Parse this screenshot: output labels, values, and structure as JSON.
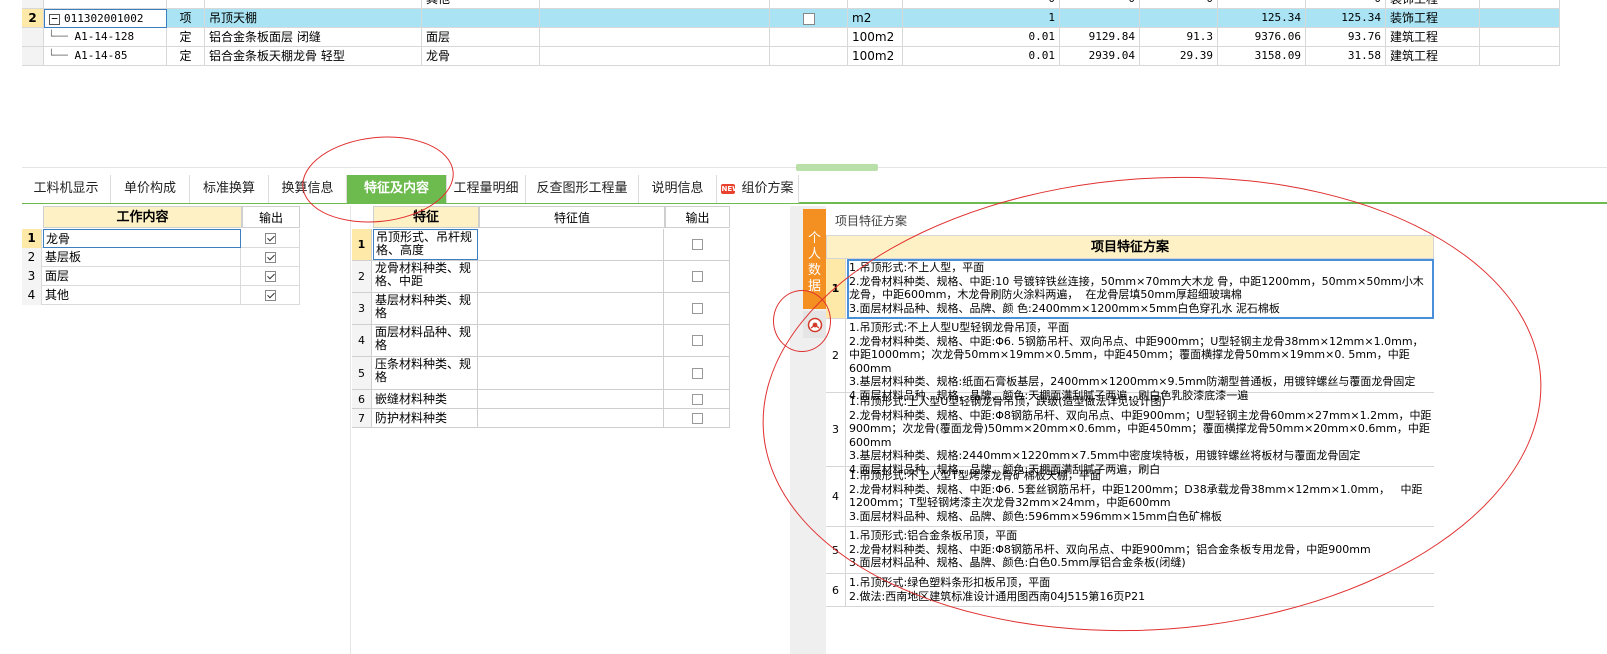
{
  "top_grid": {
    "partial_row": {
      "col_type": "其他",
      "values": [
        "0",
        "0",
        "0",
        "0"
      ],
      "category": "装饰工程"
    },
    "rows": [
      {
        "rownum": "2",
        "code": "011302001002",
        "kind": "项",
        "name": "吊顶天棚",
        "feature": "",
        "unit": "m2",
        "qty": "1",
        "v1": "",
        "v2": "",
        "v3": "125.34",
        "v4": "125.34",
        "category": "装饰工程",
        "selected": true
      },
      {
        "rownum": "",
        "code": "A1-14-128",
        "kind": "定",
        "name": "铝合金条板面层 闭缝",
        "feature": "面层",
        "unit": "100m2",
        "qty": "0.01",
        "v1": "9129.84",
        "v2": "91.3",
        "v3": "9376.06",
        "v4": "93.76",
        "category": "建筑工程",
        "selected": false
      },
      {
        "rownum": "",
        "code": "A1-14-85",
        "kind": "定",
        "name": "铝合金条板天棚龙骨 轻型",
        "feature": "龙骨",
        "unit": "100m2",
        "qty": "0.01",
        "v1": "2939.04",
        "v2": "29.39",
        "v3": "3158.09",
        "v4": "31.58",
        "category": "建筑工程",
        "selected": false
      }
    ]
  },
  "tabs": [
    {
      "label": "工料机显示",
      "active": false
    },
    {
      "label": "单价构成",
      "active": false
    },
    {
      "label": "标准换算",
      "active": false
    },
    {
      "label": "换算信息",
      "active": false
    },
    {
      "label": "特征及内容",
      "active": true
    },
    {
      "label": "工程量明细",
      "active": false
    },
    {
      "label": "反查图形工程量",
      "active": false
    },
    {
      "label": "说明信息",
      "active": false
    },
    {
      "label": "组价方案",
      "active": false,
      "badge": "NEW"
    }
  ],
  "work_content": {
    "header_name": "工作内容",
    "header_output": "输出",
    "items": [
      {
        "rownum": "1",
        "name": "龙骨",
        "checked": true
      },
      {
        "rownum": "2",
        "name": "基层板",
        "checked": true
      },
      {
        "rownum": "3",
        "name": "面层",
        "checked": true
      },
      {
        "rownum": "4",
        "name": "其他",
        "checked": true
      }
    ]
  },
  "features": {
    "header_name": "特征",
    "header_value": "特征值",
    "header_output": "输出",
    "items": [
      {
        "rownum": "1",
        "name": "吊顶形式、吊杆规格、高度",
        "value": ""
      },
      {
        "rownum": "2",
        "name": "龙骨材料种类、规格、中距",
        "value": ""
      },
      {
        "rownum": "3",
        "name": "基层材料种类、规格",
        "value": ""
      },
      {
        "rownum": "4",
        "name": "面层材料品种、规格",
        "value": ""
      },
      {
        "rownum": "5",
        "name": "压条材料种类、规格",
        "value": ""
      },
      {
        "rownum": "6",
        "name": "嵌缝材料种类",
        "value": ""
      },
      {
        "rownum": "7",
        "name": "防护材料种类",
        "value": ""
      }
    ]
  },
  "right_panel": {
    "title": "项目特征方案",
    "side_tab": "个人数据",
    "table_header": "项目特征方案",
    "plans": [
      {
        "rownum": "1",
        "text": "1.吊顶形式:不上人型，平面\n2.龙骨材料种类、规格、中距:10 号镀锌铁丝连接，50mm×70mm大木龙 骨，中距1200mm，50mm×50mm小木龙骨，中距600mm，木龙骨刷防火涂料两遍，  在龙骨层填50mm厚超细玻璃棉\n3.面层材料品种、规格、品牌、颜 色:2400mm×1200mm×5mm白色穿孔水 泥石棉板"
      },
      {
        "rownum": "2",
        "text": "1.吊顶形式:不上人型U型轻钢龙骨吊顶，平面\n2.龙骨材料种类、规格、中距:Φ6. 5钢筋吊杆、双向吊点、中距900mm；U型轻钢主龙骨38mm×12mm×1.0mm，中距1000mm；次龙骨50mm×19mm×0.5mm，中距450mm；覆面横撑龙骨50mm×19mm×0. 5mm，中距600mm\n3.基层材料种类、规格:纸面石膏板基层，2400mm×1200mm×9.5mm防潮型普通板，用镀锌螺丝与覆面龙骨固定\n4.面层材料品种、规格、晶牌、颜色:天棚面满刮腻子两遍，刷白色乳胶漆底漆一遍"
      },
      {
        "rownum": "3",
        "text": "1.吊顶形式:上人型U型轻钢龙骨吊顶，跌级(造型做法详见设计图)\n2.龙骨材料种类、规格、中距:Φ8钢筋吊杆、双向吊点、中距900mm；U型轻钢主龙骨60mm×27mm×1.2mm，中距900mm；次龙骨(覆面龙骨)50mm×20mm×0.6mm，中距450mm；覆面横撑龙骨50mm×20mm×0.6mm，中距600mm\n3.基层材料种类、规格:2440mm×1220mm×7.5mm中密度埃特板，用镀锌螺丝将板材与覆面龙骨固定\n4.面层材料品种、规格、品牌、颜色:天棚面满刮腻子两遍，刷白"
      },
      {
        "rownum": "4",
        "text": "1.吊顶形式:不上人型T型烤漆龙骨矿棉板天棚，平面\n2.龙骨材料种类、规格、中距:Φ6. 5套丝钢筋吊杆，中距1200mm；D38承载龙骨38mm×12mm×1.0mm，   中距1200mm；T型轻钢烤漆主次龙骨32mm×24mm，中距600mm\n3.面层材料品种、规格、品牌、颜色:596mm×596mm×15mm白色矿棉板"
      },
      {
        "rownum": "5",
        "text": "1.吊顶形式:铝合金条板吊顶，平面\n2.龙骨材料种类、规格、中距:Φ8钢筋吊杆、双向吊点、中距900mm；铝合金条板专用龙骨，中距900mm\n3.面层材料品种、规格、晶牌、颜色:白色0.5mm厚铝合金条板(闭缝)"
      },
      {
        "rownum": "6",
        "text": "1.吊顶形式:绿色塑料条形扣板吊顶，平面\n2.做法:西南地区建筑标准设计通用图西南04J515第16页P21"
      }
    ]
  },
  "colors": {
    "tab_active": "#6dbb4f",
    "selected_row": "#a9e3f4",
    "header_yellow": "#fff1c6",
    "side_tab": "#f39021",
    "annotation": "#e03030"
  }
}
